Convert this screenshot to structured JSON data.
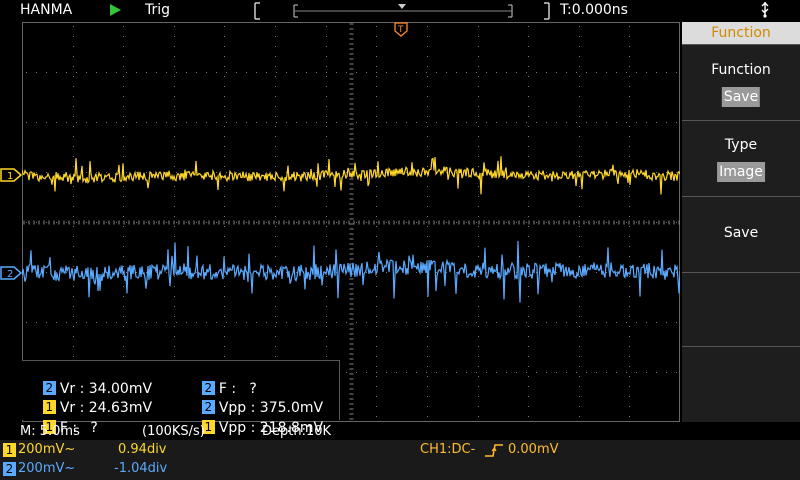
{
  "topbar": {
    "brand": "HANMA",
    "trigger_status": "Trig",
    "time_offset": "T:0.000ns"
  },
  "menu": {
    "title": "Function",
    "items": [
      {
        "label": "Function",
        "value": "Save"
      },
      {
        "label": "Type",
        "value": "Image"
      },
      {
        "label": "Save",
        "value": ""
      },
      {
        "label": "",
        "value": ""
      },
      {
        "label": "",
        "value": ""
      }
    ]
  },
  "measurements": [
    {
      "ch": "2",
      "text": "Vr : 34.00mV"
    },
    {
      "ch": "2",
      "text": "F :   ?"
    },
    {
      "ch": "1",
      "text": "Vr : 24.63mV"
    },
    {
      "ch": "2",
      "text": "Vpp : 375.0mV"
    },
    {
      "ch": "1",
      "text": "F :   ?"
    },
    {
      "ch": "1",
      "text": "Vpp : 218.8mV"
    }
  ],
  "status": {
    "timebase": "M: 5.0ms",
    "sample_rate": "(100KS/s)",
    "depth": "Depth:10K"
  },
  "channels": {
    "ch1": {
      "tag": "1",
      "scale": "200mV~",
      "position": "0.94div"
    },
    "ch2": {
      "tag": "2",
      "scale": "200mV~",
      "position": "-1.04div"
    },
    "trigger": "CH1:DC-",
    "trigger_level": "0.00mV"
  },
  "colors": {
    "ch1": "#ffd72a",
    "ch2": "#5aaaff",
    "trigger_text": "#ffbd2e"
  }
}
